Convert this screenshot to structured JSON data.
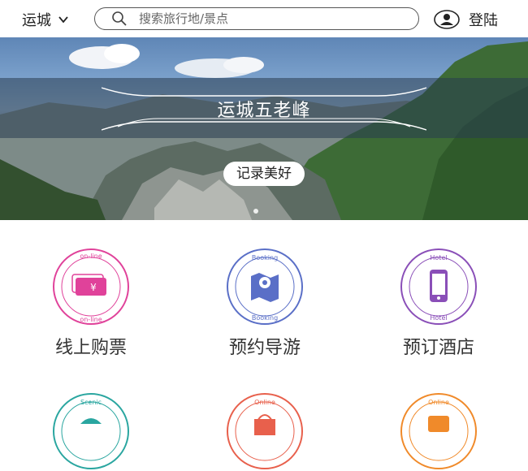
{
  "header": {
    "city": "运城",
    "search_placeholder": "搜索旅行地/景点",
    "login": "登陆"
  },
  "banner": {
    "title": "运城五老峰",
    "button": "记录美好"
  },
  "features": [
    {
      "label": "线上购票",
      "ring_text": "on-line ticket on-line ticket",
      "color": "#e0429a",
      "icon": "ticket-icon"
    },
    {
      "label": "预约导游",
      "ring_text": "Booking Guide Booking Guide",
      "color": "#5a6fc7",
      "icon": "map-guide-icon"
    },
    {
      "label": "预订酒店",
      "ring_text": "Reservation Hotel Reservation Hotel",
      "color": "#8a4fb8",
      "icon": "phone-hotel-icon"
    }
  ],
  "features_row2": [
    {
      "ring_text": "Scenic",
      "color": "#2aa6a0",
      "icon": "scenic-icon"
    },
    {
      "ring_text": "Online",
      "color": "#e8604c",
      "icon": "shopping-bag-icon"
    },
    {
      "ring_text": "Online",
      "color": "#f08a2a",
      "icon": "online-service-icon"
    }
  ]
}
